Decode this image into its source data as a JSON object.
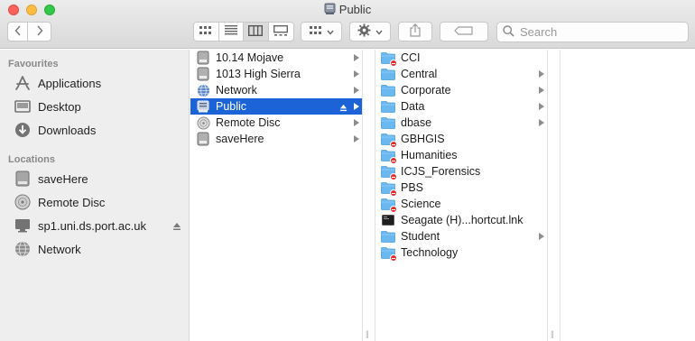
{
  "window": {
    "title": "Public"
  },
  "toolbar": {
    "search_placeholder": "Search"
  },
  "sidebar": {
    "favourites_heading": "Favourites",
    "favourites": [
      {
        "label": "Applications",
        "icon": "applications-icon"
      },
      {
        "label": "Desktop",
        "icon": "desktop-icon"
      },
      {
        "label": "Downloads",
        "icon": "downloads-icon"
      }
    ],
    "locations_heading": "Locations",
    "locations": [
      {
        "label": "saveHere",
        "icon": "disk-icon"
      },
      {
        "label": "Remote Disc",
        "icon": "disc-icon"
      },
      {
        "label": "sp1.uni.ds.port.ac.uk",
        "icon": "display-icon"
      },
      {
        "label": "Network",
        "icon": "network-icon"
      }
    ]
  },
  "column1": [
    {
      "label": "10.14 Mojave",
      "icon": "disk-icon"
    },
    {
      "label": "1013 High Sierra",
      "icon": "disk-icon"
    },
    {
      "label": "Network",
      "icon": "network-icon"
    },
    {
      "label": "Public",
      "icon": "server-icon",
      "selected": true
    },
    {
      "label": "Remote Disc",
      "icon": "disc-icon"
    },
    {
      "label": "saveHere",
      "icon": "disk-icon"
    }
  ],
  "column2": [
    {
      "label": "CCI",
      "icon": "folder-restricted-icon",
      "arrow": false
    },
    {
      "label": "Central",
      "icon": "folder-icon",
      "arrow": true
    },
    {
      "label": "Corporate",
      "icon": "folder-icon",
      "arrow": true
    },
    {
      "label": "Data",
      "icon": "folder-icon",
      "arrow": true
    },
    {
      "label": "dbase",
      "icon": "folder-icon",
      "arrow": true
    },
    {
      "label": "GBHGIS",
      "icon": "folder-restricted-icon",
      "arrow": false
    },
    {
      "label": "Humanities",
      "icon": "folder-restricted-icon",
      "arrow": false
    },
    {
      "label": "ICJS_Forensics",
      "icon": "folder-restricted-icon",
      "arrow": false
    },
    {
      "label": "PBS",
      "icon": "folder-restricted-icon",
      "arrow": false
    },
    {
      "label": "Science",
      "icon": "folder-restricted-icon",
      "arrow": false
    },
    {
      "label": "Seagate (H)...hortcut.lnk",
      "icon": "shortcut-file-icon",
      "arrow": false
    },
    {
      "label": "Student",
      "icon": "folder-icon",
      "arrow": true
    },
    {
      "label": "Technology",
      "icon": "folder-restricted-icon",
      "arrow": false
    }
  ],
  "colors": {
    "selection": "#1b63d6",
    "folder": "#6ab8f0",
    "restricted_badge": "#e0302b"
  }
}
